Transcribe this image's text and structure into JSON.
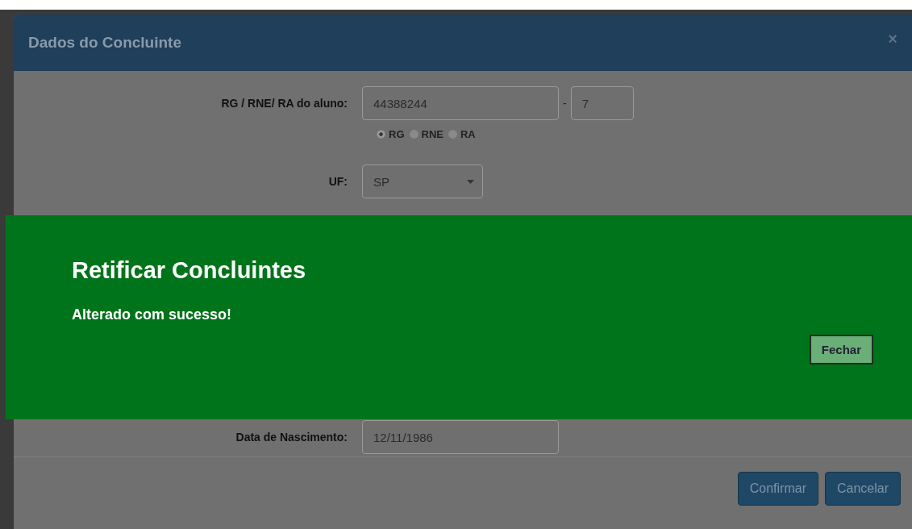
{
  "modal": {
    "title": "Dados do Concluinte",
    "close": "×",
    "document": {
      "label": "RG / RNE/ RA do aluno:",
      "number": "44388244",
      "separator": "-",
      "digit": "7"
    },
    "doc_types": [
      {
        "label": "RG",
        "selected": true
      },
      {
        "label": "RNE",
        "selected": false
      },
      {
        "label": "RA",
        "selected": false
      }
    ],
    "uf": {
      "label": "UF:",
      "value": "SP"
    },
    "birth": {
      "label": "Data de Nascimento:",
      "value": "12/11/1986"
    },
    "buttons": [
      "Confirmar",
      "Cancelar"
    ]
  },
  "alert": {
    "title": "Retificar Concluintes",
    "message": "Alterado com sucesso!",
    "button": "Fechar"
  }
}
